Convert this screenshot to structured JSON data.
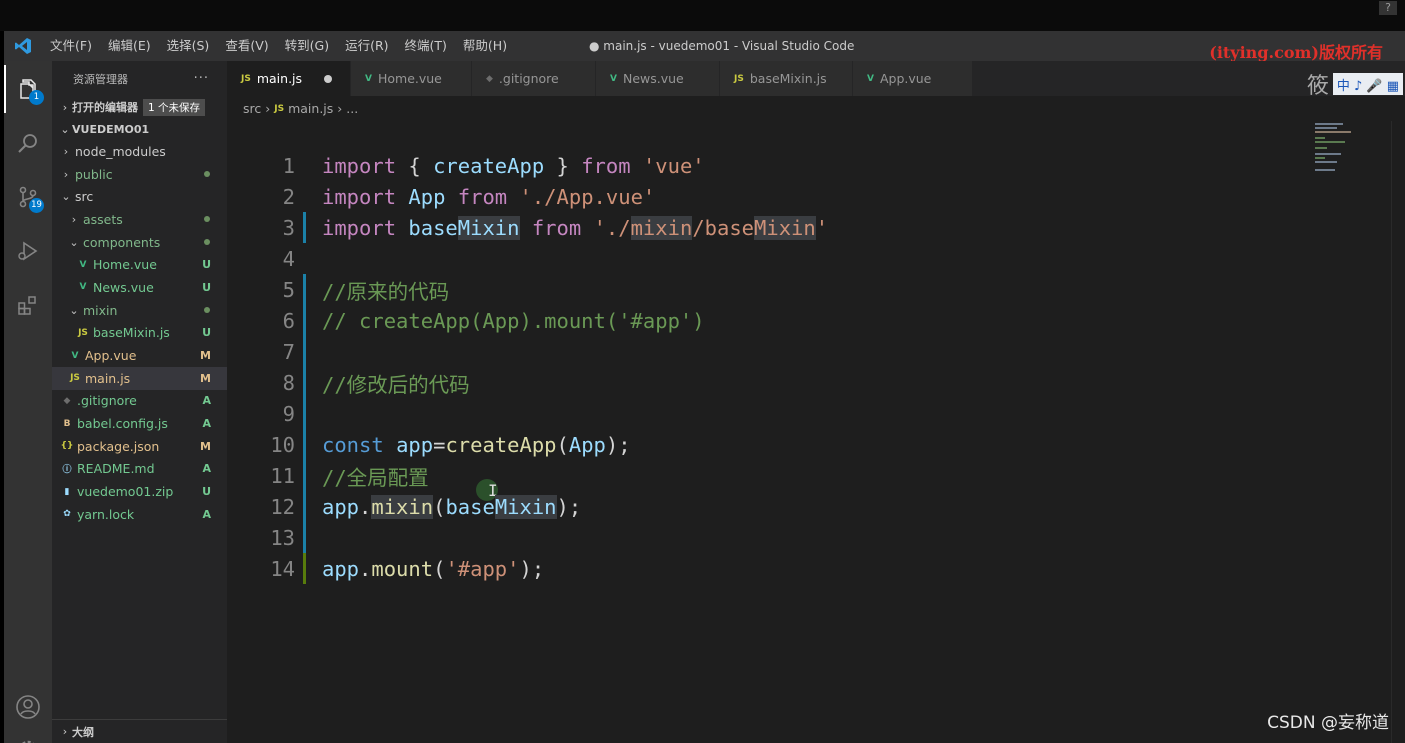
{
  "titlebar": {
    "menu": [
      "文件(F)",
      "编辑(E)",
      "选择(S)",
      "查看(V)",
      "转到(G)",
      "运行(R)",
      "终端(T)",
      "帮助(H)"
    ],
    "window_title": "● main.js - vuedemo01 - Visual Studio Code",
    "watermark": "(itying.com)版权所有"
  },
  "activity": {
    "explorer_badge": "1",
    "scm_badge": "19"
  },
  "sidebar": {
    "title": "资源管理器",
    "more": "···",
    "open_editors": "打开的编辑器",
    "unsaved": "1 个未保存",
    "project": "VUEDEMO01",
    "tree": [
      {
        "name": "node_modules",
        "indent": 1,
        "type": "folder",
        "open": false,
        "status": "",
        "dot": false
      },
      {
        "name": "public",
        "indent": 1,
        "type": "folder",
        "open": false,
        "status": "",
        "dot": true
      },
      {
        "name": "src",
        "indent": 1,
        "type": "folder",
        "open": true,
        "status": "",
        "dot": false
      },
      {
        "name": "assets",
        "indent": 2,
        "type": "folder",
        "open": false,
        "status": "",
        "dot": true
      },
      {
        "name": "components",
        "indent": 2,
        "type": "folder",
        "open": true,
        "status": "",
        "dot": true
      },
      {
        "name": "Home.vue",
        "indent": 3,
        "type": "vue",
        "status": "U"
      },
      {
        "name": "News.vue",
        "indent": 3,
        "type": "vue",
        "status": "U"
      },
      {
        "name": "mixin",
        "indent": 2,
        "type": "folder",
        "open": true,
        "status": "",
        "dot": true
      },
      {
        "name": "baseMixin.js",
        "indent": 3,
        "type": "js",
        "status": "U"
      },
      {
        "name": "App.vue",
        "indent": 2,
        "type": "vue",
        "status": "M"
      },
      {
        "name": "main.js",
        "indent": 2,
        "type": "js",
        "status": "M",
        "selected": true
      },
      {
        "name": ".gitignore",
        "indent": 1,
        "type": "git",
        "status": "A"
      },
      {
        "name": "babel.config.js",
        "indent": 1,
        "type": "babel",
        "status": "A"
      },
      {
        "name": "package.json",
        "indent": 1,
        "type": "json",
        "status": "M"
      },
      {
        "name": "README.md",
        "indent": 1,
        "type": "info",
        "status": "A"
      },
      {
        "name": "vuedemo01.zip",
        "indent": 1,
        "type": "zip",
        "status": "U"
      },
      {
        "name": "yarn.lock",
        "indent": 1,
        "type": "yarn",
        "status": "A"
      }
    ],
    "outline": "大纲"
  },
  "tabs": [
    {
      "label": "main.js",
      "icon": "JS",
      "kind": "js",
      "active": true,
      "modified": true
    },
    {
      "label": "Home.vue",
      "icon": "V",
      "kind": "vue"
    },
    {
      "label": ".gitignore",
      "icon": "◆",
      "kind": "git"
    },
    {
      "label": "News.vue",
      "icon": "V",
      "kind": "vue"
    },
    {
      "label": "baseMixin.js",
      "icon": "JS",
      "kind": "js"
    },
    {
      "label": "App.vue",
      "icon": "V",
      "kind": "vue"
    }
  ],
  "right_overlay": {
    "text": "筱",
    "ime": "中 ♪ 🎤 ▦"
  },
  "breadcrumb": {
    "folder": "src",
    "file": "main.js",
    "rest": "..."
  },
  "code": {
    "line_numbers": [
      "1",
      "2",
      "3",
      "4",
      "5",
      "6",
      "7",
      "8",
      "9",
      "10",
      "11",
      "12",
      "13",
      "14"
    ],
    "lines": [
      [
        [
          "kw2",
          "import"
        ],
        [
          "pl",
          " { "
        ],
        [
          "id",
          "createApp"
        ],
        [
          "pl",
          " } "
        ],
        [
          "kw2",
          "from"
        ],
        [
          "pl",
          " "
        ],
        [
          "str",
          "'vue'"
        ]
      ],
      [
        [
          "kw2",
          "import"
        ],
        [
          "pl",
          " "
        ],
        [
          "id",
          "App"
        ],
        [
          "pl",
          " "
        ],
        [
          "kw2",
          "from"
        ],
        [
          "pl",
          " "
        ],
        [
          "str",
          "'./App.vue'"
        ]
      ],
      [
        [
          "kw2",
          "import"
        ],
        [
          "pl",
          " "
        ],
        [
          "id",
          "base"
        ],
        [
          "id hl",
          "Mixin"
        ],
        [
          "pl",
          " "
        ],
        [
          "kw2",
          "from"
        ],
        [
          "pl",
          " "
        ],
        [
          "str",
          "'./"
        ],
        [
          "str hl",
          "mixin"
        ],
        [
          "str",
          "/base"
        ],
        [
          "str hl",
          "Mixin"
        ],
        [
          "str",
          "'"
        ]
      ],
      [],
      [
        [
          "cm",
          "//原来的代码"
        ]
      ],
      [
        [
          "cm",
          "// createApp(App).mount('#app')"
        ]
      ],
      [],
      [
        [
          "cm",
          "//修改后的代码"
        ]
      ],
      [],
      [
        [
          "kw",
          "const"
        ],
        [
          "pl",
          " "
        ],
        [
          "id",
          "app"
        ],
        [
          "pl",
          "="
        ],
        [
          "fn",
          "createApp"
        ],
        [
          "pl",
          "("
        ],
        [
          "id",
          "App"
        ],
        [
          "pl",
          ");"
        ]
      ],
      [
        [
          "cm",
          "//全局配置"
        ]
      ],
      [
        [
          "id",
          "app"
        ],
        [
          "pl",
          "."
        ],
        [
          "fn hl",
          "mixin"
        ],
        [
          "pl",
          "("
        ],
        [
          "id",
          "bas"
        ],
        [
          "id",
          "e"
        ],
        [
          "id hl",
          "Mixin"
        ],
        [
          "pl",
          ");"
        ]
      ],
      [],
      [
        [
          "id",
          "app"
        ],
        [
          "pl",
          "."
        ],
        [
          "fn",
          "mount"
        ],
        [
          "pl",
          "("
        ],
        [
          "str",
          "'#app'"
        ],
        [
          "pl",
          ");"
        ]
      ]
    ],
    "gutter": [
      "",
      "",
      "mod",
      "",
      "mod",
      "mod",
      "mod",
      "mod",
      "mod",
      "mod",
      "mod",
      "mod",
      "mod",
      "add"
    ]
  },
  "footer_watermark": "CSDN @妄称道",
  "colors": {
    "accent": "#007acc",
    "vue": "#41b883",
    "js": "#cbcb41",
    "git_untracked": "#73c991",
    "git_modified": "#e2c08d"
  }
}
